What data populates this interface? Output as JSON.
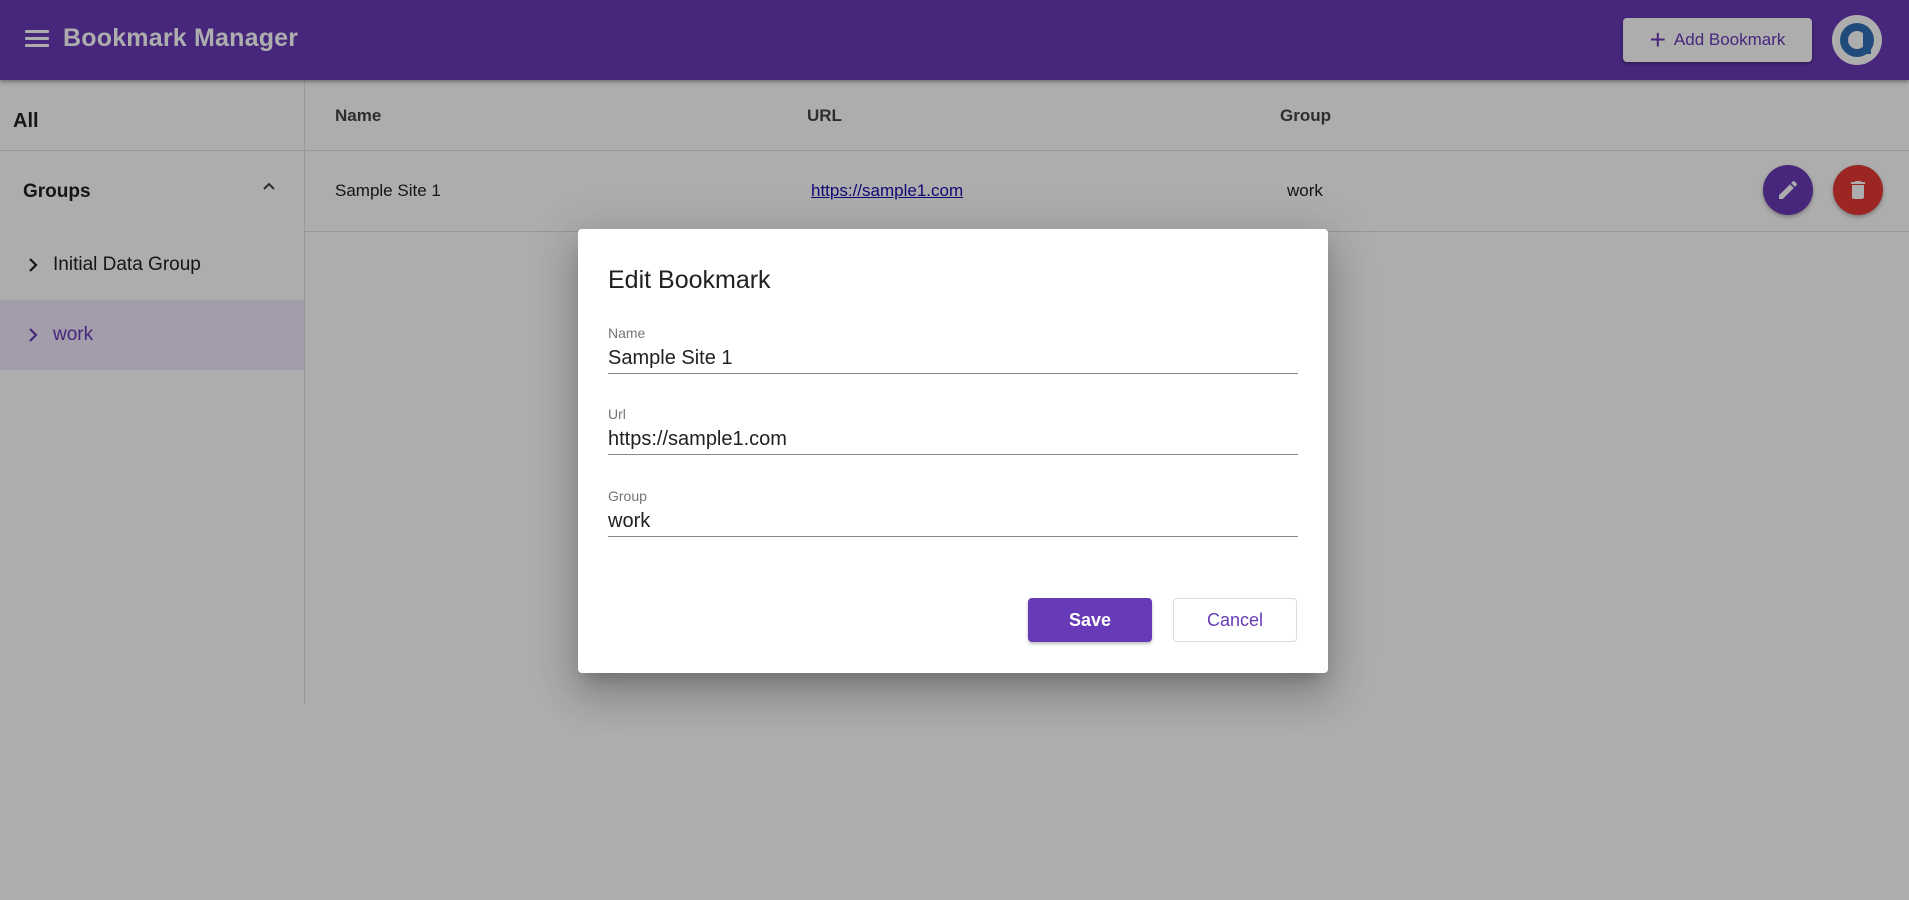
{
  "header": {
    "title": "Bookmark Manager",
    "add_button_label": "Add Bookmark",
    "menu_icon": "menu-icon",
    "avatar_icon": "logo-icon"
  },
  "sidebar": {
    "all_label": "All",
    "groups_label": "Groups",
    "groups": [
      {
        "label": "Initial Data Group",
        "active": false
      },
      {
        "label": "work",
        "active": true
      }
    ]
  },
  "table": {
    "columns": [
      "Name",
      "URL",
      "Group"
    ],
    "rows": [
      {
        "name": "Sample Site 1",
        "url": "https://sample1.com",
        "group": "work"
      }
    ]
  },
  "dialog": {
    "title": "Edit Bookmark",
    "fields": [
      {
        "label": "Name",
        "value": "Sample Site 1"
      },
      {
        "label": "Url",
        "value": "https://sample1.com"
      },
      {
        "label": "Group",
        "value": "work"
      }
    ],
    "save_label": "Save",
    "cancel_label": "Cancel"
  },
  "colors": {
    "primary": "#673ab7",
    "danger": "#e53935",
    "link": "#1a0dab"
  }
}
